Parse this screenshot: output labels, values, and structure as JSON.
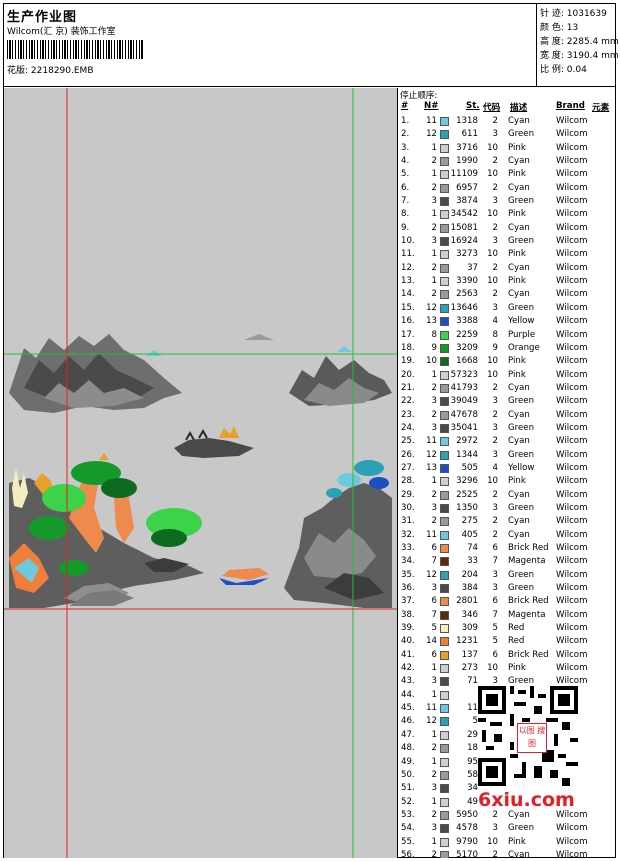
{
  "header": {
    "title": "生产作业图",
    "studio": "Wilcom(汇 京) 装饰工作室",
    "design_label": "花版:",
    "design_value": "2218290.EMB"
  },
  "specs": [
    {
      "label": "针 迹:",
      "value": "1031639"
    },
    {
      "label": "颜 色:",
      "value": "13"
    },
    {
      "label": "高 度:",
      "value": "2285.4 mm"
    },
    {
      "label": "宽 度:",
      "value": "3190.4 mm"
    },
    {
      "label": "比 例:",
      "value": "0.04"
    }
  ],
  "stop_sequence": {
    "label": "停止顺序:",
    "columns": {
      "idx": "#",
      "n": "N#",
      "st": "St.",
      "code": "代码",
      "desc": "描述",
      "brand": "Brand",
      "element": "元素"
    },
    "rows": [
      {
        "i": "1.",
        "n": "11",
        "st": "1318",
        "code": "2",
        "desc": "Cyan",
        "brand": "Wilcom",
        "color": "#6fc9dc"
      },
      {
        "i": "2.",
        "n": "12",
        "st": "611",
        "code": "3",
        "desc": "Green",
        "brand": "Wilcom",
        "color": "#2aa1b5"
      },
      {
        "i": "3.",
        "n": "1",
        "st": "3716",
        "code": "10",
        "desc": "Pink",
        "brand": "Wilcom",
        "color": "#cfcfcf"
      },
      {
        "i": "4.",
        "n": "2",
        "st": "1990",
        "code": "2",
        "desc": "Cyan",
        "brand": "Wilcom",
        "color": "#9a9a9a"
      },
      {
        "i": "5.",
        "n": "1",
        "st": "11109",
        "code": "10",
        "desc": "Pink",
        "brand": "Wilcom",
        "color": "#cfcfcf"
      },
      {
        "i": "6.",
        "n": "2",
        "st": "6957",
        "code": "2",
        "desc": "Cyan",
        "brand": "Wilcom",
        "color": "#9a9a9a"
      },
      {
        "i": "7.",
        "n": "3",
        "st": "3874",
        "code": "3",
        "desc": "Green",
        "brand": "Wilcom",
        "color": "#4a4a4a"
      },
      {
        "i": "8.",
        "n": "1",
        "st": "34542",
        "code": "10",
        "desc": "Pink",
        "brand": "Wilcom",
        "color": "#cfcfcf"
      },
      {
        "i": "9.",
        "n": "2",
        "st": "15081",
        "code": "2",
        "desc": "Cyan",
        "brand": "Wilcom",
        "color": "#9a9a9a"
      },
      {
        "i": "10.",
        "n": "3",
        "st": "16924",
        "code": "3",
        "desc": "Green",
        "brand": "Wilcom",
        "color": "#4a4a4a"
      },
      {
        "i": "11.",
        "n": "1",
        "st": "3273",
        "code": "10",
        "desc": "Pink",
        "brand": "Wilcom",
        "color": "#cfcfcf"
      },
      {
        "i": "12.",
        "n": "2",
        "st": "37",
        "code": "2",
        "desc": "Cyan",
        "brand": "Wilcom",
        "color": "#9a9a9a"
      },
      {
        "i": "13.",
        "n": "1",
        "st": "3390",
        "code": "10",
        "desc": "Pink",
        "brand": "Wilcom",
        "color": "#cfcfcf"
      },
      {
        "i": "14.",
        "n": "2",
        "st": "2563",
        "code": "2",
        "desc": "Cyan",
        "brand": "Wilcom",
        "color": "#9a9a9a"
      },
      {
        "i": "15.",
        "n": "12",
        "st": "13646",
        "code": "3",
        "desc": "Green",
        "brand": "Wilcom",
        "color": "#2aa1b5"
      },
      {
        "i": "16.",
        "n": "13",
        "st": "3388",
        "code": "4",
        "desc": "Yellow",
        "brand": "Wilcom",
        "color": "#1c4fc4"
      },
      {
        "i": "17.",
        "n": "8",
        "st": "2259",
        "code": "8",
        "desc": "Purple",
        "brand": "Wilcom",
        "color": "#3ed14a"
      },
      {
        "i": "18.",
        "n": "9",
        "st": "3209",
        "code": "9",
        "desc": "Orange",
        "brand": "Wilcom",
        "color": "#139a2a"
      },
      {
        "i": "19.",
        "n": "10",
        "st": "1668",
        "code": "10",
        "desc": "Pink",
        "brand": "Wilcom",
        "color": "#0d6b1f"
      },
      {
        "i": "20.",
        "n": "1",
        "st": "57323",
        "code": "10",
        "desc": "Pink",
        "brand": "Wilcom",
        "color": "#cfcfcf"
      },
      {
        "i": "21.",
        "n": "2",
        "st": "41793",
        "code": "2",
        "desc": "Cyan",
        "brand": "Wilcom",
        "color": "#9a9a9a"
      },
      {
        "i": "22.",
        "n": "3",
        "st": "39049",
        "code": "3",
        "desc": "Green",
        "brand": "Wilcom",
        "color": "#4a4a4a"
      },
      {
        "i": "23.",
        "n": "2",
        "st": "47678",
        "code": "2",
        "desc": "Cyan",
        "brand": "Wilcom",
        "color": "#9a9a9a"
      },
      {
        "i": "24.",
        "n": "3",
        "st": "35041",
        "code": "3",
        "desc": "Green",
        "brand": "Wilcom",
        "color": "#4a4a4a"
      },
      {
        "i": "25.",
        "n": "11",
        "st": "2972",
        "code": "2",
        "desc": "Cyan",
        "brand": "Wilcom",
        "color": "#6fc9dc"
      },
      {
        "i": "26.",
        "n": "12",
        "st": "1344",
        "code": "3",
        "desc": "Green",
        "brand": "Wilcom",
        "color": "#2aa1b5"
      },
      {
        "i": "27.",
        "n": "13",
        "st": "505",
        "code": "4",
        "desc": "Yellow",
        "brand": "Wilcom",
        "color": "#1c4fc4"
      },
      {
        "i": "28.",
        "n": "1",
        "st": "3296",
        "code": "10",
        "desc": "Pink",
        "brand": "Wilcom",
        "color": "#cfcfcf"
      },
      {
        "i": "29.",
        "n": "2",
        "st": "2525",
        "code": "2",
        "desc": "Cyan",
        "brand": "Wilcom",
        "color": "#9a9a9a"
      },
      {
        "i": "30.",
        "n": "3",
        "st": "1350",
        "code": "3",
        "desc": "Green",
        "brand": "Wilcom",
        "color": "#4a4a4a"
      },
      {
        "i": "31.",
        "n": "2",
        "st": "275",
        "code": "2",
        "desc": "Cyan",
        "brand": "Wilcom",
        "color": "#9a9a9a"
      },
      {
        "i": "32.",
        "n": "11",
        "st": "405",
        "code": "2",
        "desc": "Cyan",
        "brand": "Wilcom",
        "color": "#6fc9dc"
      },
      {
        "i": "33.",
        "n": "6",
        "st": "74",
        "code": "6",
        "desc": "Brick Red",
        "brand": "Wilcom",
        "color": "#ef8a4e"
      },
      {
        "i": "34.",
        "n": "7",
        "st": "33",
        "code": "7",
        "desc": "Magenta",
        "brand": "Wilcom",
        "color": "#5a2a0a"
      },
      {
        "i": "35.",
        "n": "12",
        "st": "204",
        "code": "3",
        "desc": "Green",
        "brand": "Wilcom",
        "color": "#2aa1b5"
      },
      {
        "i": "36.",
        "n": "3",
        "st": "384",
        "code": "3",
        "desc": "Green",
        "brand": "Wilcom",
        "color": "#4a4a4a"
      },
      {
        "i": "37.",
        "n": "6",
        "st": "2801",
        "code": "6",
        "desc": "Brick Red",
        "brand": "Wilcom",
        "color": "#ef8a4e"
      },
      {
        "i": "38.",
        "n": "7",
        "st": "346",
        "code": "7",
        "desc": "Magenta",
        "brand": "Wilcom",
        "color": "#5a2a0a"
      },
      {
        "i": "39.",
        "n": "5",
        "st": "309",
        "code": "5",
        "desc": "Red",
        "brand": "Wilcom",
        "color": "#f7ecc0"
      },
      {
        "i": "40.",
        "n": "14",
        "st": "1231",
        "code": "5",
        "desc": "Red",
        "brand": "Wilcom",
        "color": "#f07d3a"
      },
      {
        "i": "41.",
        "n": "6",
        "st": "137",
        "code": "6",
        "desc": "Brick Red",
        "brand": "Wilcom",
        "color": "#e8a02a"
      },
      {
        "i": "42.",
        "n": "1",
        "st": "273",
        "code": "10",
        "desc": "Pink",
        "brand": "Wilcom",
        "color": "#cfcfcf"
      },
      {
        "i": "43.",
        "n": "3",
        "st": "71",
        "code": "3",
        "desc": "Green",
        "brand": "Wilcom",
        "color": "#4a4a4a"
      },
      {
        "i": "44.",
        "n": "1",
        "st": "",
        "code": "",
        "desc": "",
        "brand": "",
        "color": "#cfcfcf"
      },
      {
        "i": "45.",
        "n": "11",
        "st": "11",
        "code": "",
        "desc": "",
        "brand": "",
        "color": "#6fc9dc"
      },
      {
        "i": "46.",
        "n": "12",
        "st": "5",
        "code": "",
        "desc": "",
        "brand": "",
        "color": "#2aa1b5"
      },
      {
        "i": "47.",
        "n": "1",
        "st": "29",
        "code": "",
        "desc": "",
        "brand": "",
        "color": "#cfcfcf"
      },
      {
        "i": "48.",
        "n": "2",
        "st": "18",
        "code": "",
        "desc": "",
        "brand": "",
        "color": "#9a9a9a"
      },
      {
        "i": "49.",
        "n": "1",
        "st": "95",
        "code": "",
        "desc": "",
        "brand": "",
        "color": "#cfcfcf"
      },
      {
        "i": "50.",
        "n": "2",
        "st": "58",
        "code": "",
        "desc": "",
        "brand": "",
        "color": "#9a9a9a"
      },
      {
        "i": "51.",
        "n": "3",
        "st": "34",
        "code": "",
        "desc": "",
        "brand": "",
        "color": "#4a4a4a"
      },
      {
        "i": "52.",
        "n": "1",
        "st": "49",
        "code": "",
        "desc": "",
        "brand": "",
        "color": "#cfcfcf"
      },
      {
        "i": "53.",
        "n": "2",
        "st": "5950",
        "code": "2",
        "desc": "Cyan",
        "brand": "Wilcom",
        "color": "#9a9a9a"
      },
      {
        "i": "54.",
        "n": "3",
        "st": "4578",
        "code": "3",
        "desc": "Green",
        "brand": "Wilcom",
        "color": "#4a4a4a"
      },
      {
        "i": "55.",
        "n": "1",
        "st": "9790",
        "code": "10",
        "desc": "Pink",
        "brand": "Wilcom",
        "color": "#cfcfcf"
      },
      {
        "i": "56.",
        "n": "2",
        "st": "5170",
        "code": "2",
        "desc": "Cyan",
        "brand": "Wilcom",
        "color": "#9a9a9a"
      }
    ]
  },
  "watermark": {
    "text": "6xiu.com",
    "stamp": "以图 搜图"
  },
  "colors": {
    "guide_red": "#e41e26",
    "guide_green": "#22c02a",
    "canvas_bg": "#c8c8c8"
  }
}
